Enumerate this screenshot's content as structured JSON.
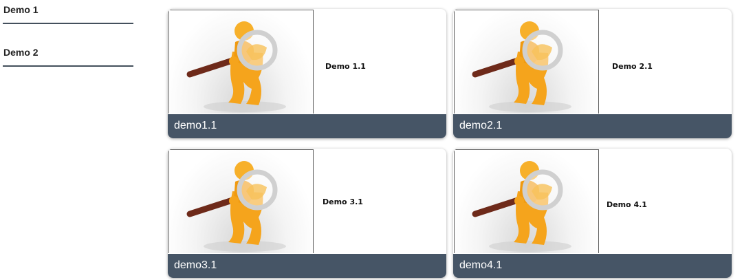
{
  "sidebar": {
    "items": [
      {
        "label": "Demo 1"
      },
      {
        "label": "Demo 2"
      }
    ]
  },
  "cards": [
    {
      "text": "Demo 1.1",
      "caption": "demo1.1",
      "image_icon": "magnifier-figure-icon"
    },
    {
      "text": "Demo 2.1",
      "caption": "demo2.1",
      "image_icon": "magnifier-figure-icon"
    },
    {
      "text": "Demo 3.1",
      "caption": "demo3.1",
      "image_icon": "magnifier-figure-icon"
    },
    {
      "text": "Demo 4.1",
      "caption": "demo4.1",
      "image_icon": "magnifier-figure-icon"
    }
  ],
  "colors": {
    "caption_bar": "#465566",
    "sidebar_rule": "#44505c",
    "figure_orange": "#f5a41c",
    "handle_brown": "#6e2a1a"
  }
}
